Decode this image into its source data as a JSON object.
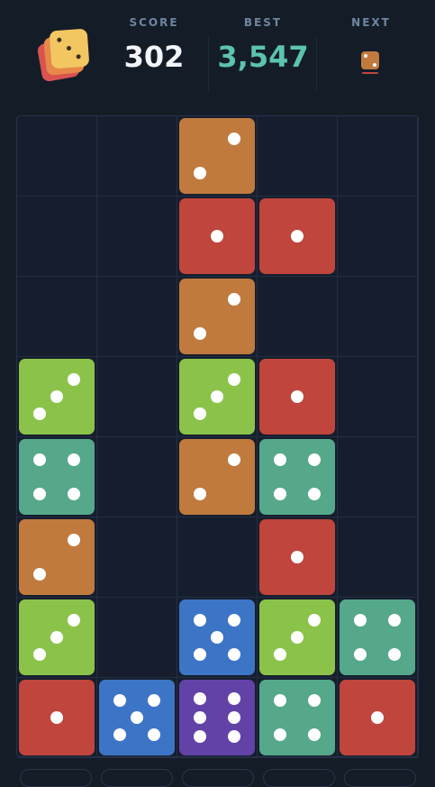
{
  "header": {
    "score_label": "SCORE",
    "score_value": "302",
    "best_label": "BEST",
    "best_value": "3,547",
    "next_label": "NEXT",
    "next_die": {
      "value": 2,
      "color": "#c07a3e"
    }
  },
  "colors": {
    "1": "#c0453d",
    "2": "#c07a3e",
    "3": "#8bc34a",
    "4": "#55a88a",
    "5": "#3d75c6",
    "6": "#6342a8"
  },
  "board": {
    "cols": 5,
    "rows": 8,
    "dice": [
      [
        0,
        0,
        2,
        0,
        0
      ],
      [
        0,
        0,
        1,
        1,
        0
      ],
      [
        0,
        0,
        2,
        0,
        0
      ],
      [
        3,
        0,
        3,
        1,
        0
      ],
      [
        4,
        0,
        2,
        4,
        0
      ],
      [
        2,
        0,
        0,
        1,
        0
      ],
      [
        3,
        0,
        5,
        3,
        4
      ],
      [
        1,
        5,
        6,
        4,
        1
      ]
    ]
  }
}
